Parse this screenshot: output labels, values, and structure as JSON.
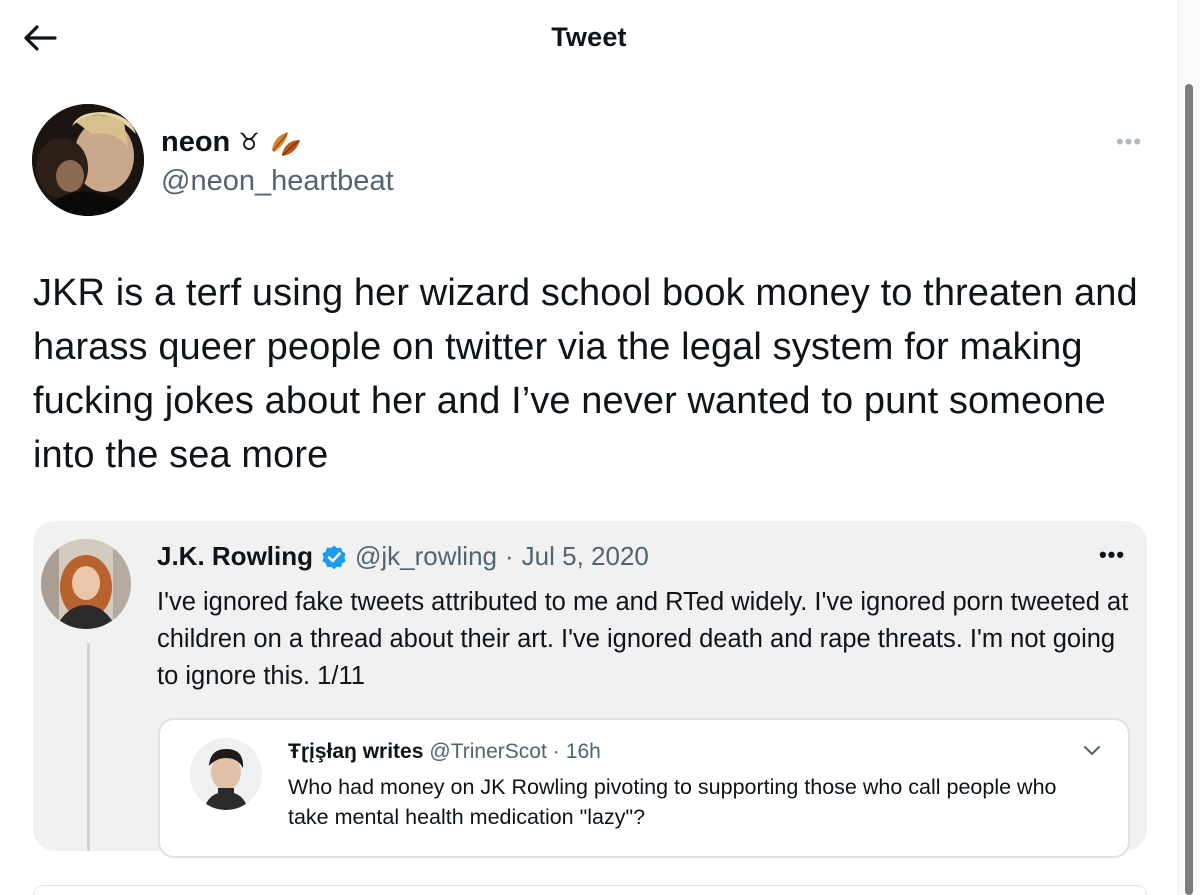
{
  "header": {
    "title": "Tweet",
    "back_icon": "arrow-left-icon"
  },
  "tweet": {
    "author_name": "neon",
    "name_emoji": "♉︎",
    "name_icon": "autumn-leaves-icon",
    "handle": "@neon_heartbeat",
    "more_icon": "more-horizontal-icon",
    "text": "JKR is a terf using her wizard school book money to threaten and harass queer people on twitter via the legal system for making fucking jokes about her and I’ve never wanted to punt someone into the sea more"
  },
  "quoted": {
    "name": "J.K. Rowling",
    "verified_icon": "verified-badge-icon",
    "handle": "@jk_rowling",
    "separator": "·",
    "date": "Jul 5, 2020",
    "text": "I've ignored fake tweets attributed to me and RTed widely. I've ignored porn tweeted at children on a thread about their art. I've ignored death and rape threats. I'm not going to ignore this. 1/11",
    "nested": {
      "name": "Ŧɽįşłaŋ writes",
      "handle": "@TrinerScot",
      "separator": "·",
      "time": "16h",
      "text": "Who had money on JK Rowling pivoting to supporting those who call people who take mental health medication \"lazy\"?",
      "chevron_icon": "chevron-down-icon"
    }
  },
  "colors": {
    "text_primary": "#0f1419",
    "text_secondary": "#536471",
    "verified_blue": "#1d9bf0",
    "card_bg": "#f1f1f2"
  }
}
